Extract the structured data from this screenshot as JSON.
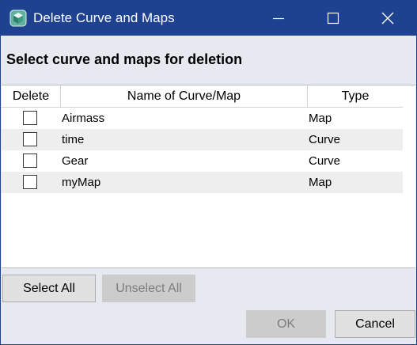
{
  "window": {
    "title": "Delete Curve and Maps",
    "colors": {
      "titlebar": "#1e4290",
      "body": "#e6e9ef"
    }
  },
  "heading": "Select curve and maps for deletion",
  "table": {
    "columns": [
      "Delete",
      "Name of Curve/Map",
      "Type"
    ],
    "rows": [
      {
        "checked": false,
        "name": "Airmass",
        "type": "Map"
      },
      {
        "checked": false,
        "name": "time",
        "type": "Curve"
      },
      {
        "checked": false,
        "name": "Gear",
        "type": "Curve"
      },
      {
        "checked": false,
        "name": "myMap",
        "type": "Map"
      }
    ]
  },
  "buttons": {
    "select_all": "Select All",
    "unselect_all": "Unselect All",
    "ok": "OK",
    "cancel": "Cancel"
  },
  "icons": {
    "app": "app-cube-icon",
    "minimize": "minimize-icon",
    "maximize": "maximize-icon",
    "close": "close-icon"
  }
}
